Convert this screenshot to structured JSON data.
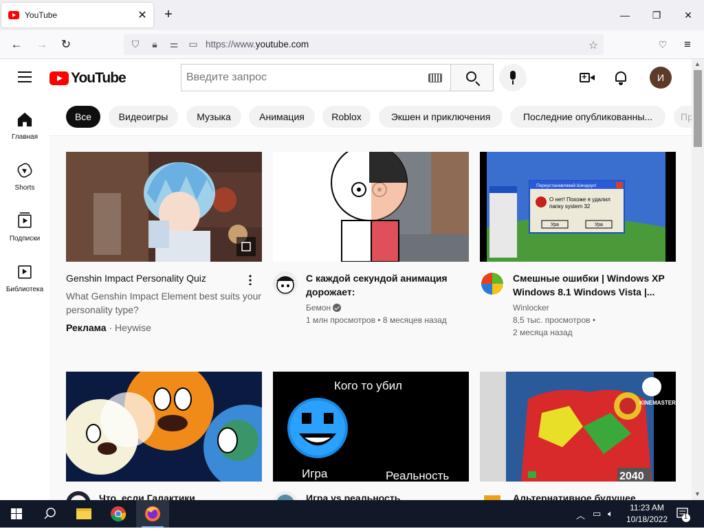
{
  "browser": {
    "tab_title": "YouTube",
    "tab_close": "✕",
    "new_tab": "+",
    "url_prefix": "https://www.",
    "url_domain": "youtube.com",
    "window_controls": {
      "minimize": "—",
      "maximize": "❐",
      "close": "✕"
    }
  },
  "masthead": {
    "logo_text": "YouTube",
    "search_placeholder": "Введите запрос",
    "avatar_letter": "И"
  },
  "sidebar": {
    "items": [
      {
        "label": "Главная",
        "icon": "home-icon"
      },
      {
        "label": "Shorts",
        "icon": "shorts-icon"
      },
      {
        "label": "Подписки",
        "icon": "subscriptions-icon"
      },
      {
        "label": "Библиотека",
        "icon": "library-icon"
      }
    ]
  },
  "chips": [
    "Все",
    "Видеоигры",
    "Музыка",
    "Анимация",
    "Roblox",
    "Экшен и приключения",
    "Последние опубликованны...",
    "Пр"
  ],
  "videos": [
    {
      "type": "ad",
      "title": "Genshin Impact Personality Quiz",
      "description": "What Genshin Impact Element best suits your personality type?",
      "ad_label": "Реклама",
      "advertiser": "Heywise"
    },
    {
      "title": "С каждой секундой анимация дорожает:",
      "channel": "Бемон",
      "views": "1 млн просмотров",
      "age": "8 месяцев назад"
    },
    {
      "title": "Смешные ошибки | Windows XP Windows 8.1 Windows Vista |...",
      "channel": "Winlocker",
      "views": "8,5 тыс. просмотров",
      "age": "2 месяца назад",
      "thumb_dialog_title": "Переустанавливай Шиндоус!",
      "thumb_dialog_text": "О нет! Похоже я удалил папку system 32",
      "thumb_dialog_btn": "Ура"
    },
    {
      "title": "Что, если Галактики"
    },
    {
      "title": "Игра vs реальность",
      "thumb_caption_top": "Кого то убил",
      "thumb_caption_left": "Игра",
      "thumb_caption_right": "Реальность"
    },
    {
      "title": "Альтернативное будущее",
      "thumb_watermark": "KINEMASTER",
      "thumb_year": "2040"
    }
  ],
  "taskbar": {
    "time": "11:23 AM",
    "date": "10/18/2022",
    "notification_count": "1"
  }
}
